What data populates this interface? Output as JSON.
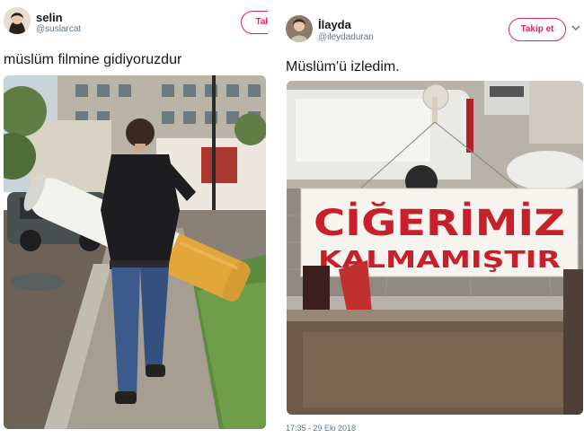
{
  "left_tweet": {
    "name": "selin",
    "handle": "@suslarcat",
    "follow_label": "Takip et",
    "text": "müslüm filmine gidiyoruzdur"
  },
  "right_tweet": {
    "name": "İlayda",
    "handle": "@ileydaduran",
    "follow_label": "Takip et",
    "text": "Müslüm'ü izledim.",
    "sign_line1": "CİĞERİMİZ",
    "sign_line2": "KALMAMIŞTIR",
    "timestamp": "17:35 - 29 Eki 2018"
  },
  "colors": {
    "accent": "#e0245e",
    "sign_red": "#c8202a"
  }
}
